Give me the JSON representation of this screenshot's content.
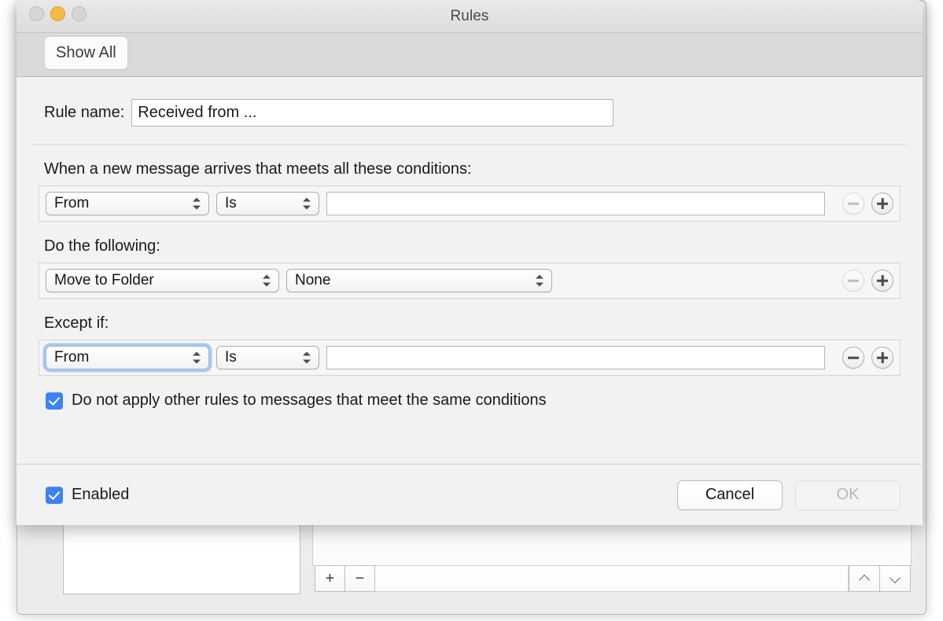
{
  "window": {
    "title": "Rules",
    "traffic_lights": [
      "close-light",
      "minimize-light",
      "zoom-light"
    ],
    "toolbar": {
      "show_all_label": "Show All"
    }
  },
  "sheet": {
    "rule_name": {
      "label": "Rule name:",
      "value": "Received from ...",
      "placeholder": ""
    },
    "conditions": {
      "heading": "When a new message arrives that meets all these conditions:",
      "rows": [
        {
          "field": "From",
          "operator": "Is",
          "value": "",
          "remove_label": "remove-row",
          "add_label": "add-row",
          "remove_enabled": false,
          "add_enabled": true,
          "focused": false
        }
      ]
    },
    "actions": {
      "heading": "Do the following:",
      "rows": [
        {
          "action": "Move to Folder",
          "target": "None",
          "remove_label": "remove-row",
          "add_label": "add-row",
          "remove_enabled": false,
          "add_enabled": true
        }
      ]
    },
    "exceptions": {
      "heading": "Except if:",
      "rows": [
        {
          "field": "From",
          "operator": "Is",
          "value": "",
          "remove_label": "remove-row",
          "add_label": "add-row",
          "remove_enabled": true,
          "add_enabled": true,
          "focused": true
        }
      ]
    },
    "stop_rules_checkbox": {
      "label": "Do not apply other rules to messages that meet the same conditions",
      "checked": true
    },
    "footer": {
      "enabled_checkbox": {
        "label": "Enabled",
        "checked": true
      },
      "cancel_label": "Cancel",
      "ok_label": "OK",
      "ok_enabled": false
    }
  },
  "background_window": {
    "add_label": "+",
    "remove_label": "−",
    "move_up_label": "move-up",
    "move_down_label": "move-down"
  },
  "colors": {
    "accent_blue": "#3b82f6",
    "focus_ring": "#64a5eb",
    "minimize_yellow": "#f6bb42",
    "sheet_bg": "#f2f2f2",
    "window_bg": "#ececec"
  }
}
